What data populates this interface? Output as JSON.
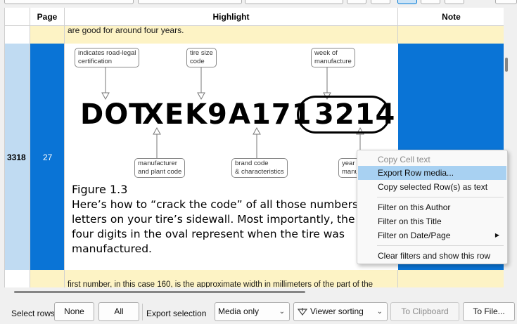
{
  "grid": {
    "columns": [
      "Page",
      "Highlight",
      "Note"
    ],
    "rows": [
      {
        "highlight": "are good for around four years."
      },
      {
        "id": "3318",
        "page": "27",
        "figure": {
          "callouts": {
            "certification": [
              "indicates road-legal",
              "certification"
            ],
            "tire_size": [
              "tire size",
              "code"
            ],
            "week": [
              "week of",
              "manufacture"
            ],
            "manufacturer": [
              "manufacturer",
              "and plant code"
            ],
            "brand": [
              "brand code",
              "& characteristics"
            ],
            "year": [
              "year o",
              "manu"
            ]
          },
          "code_parts": [
            "DOT",
            "XE",
            "K9",
            "A171",
            "3214"
          ],
          "title": "Figure 1.3",
          "caption": "Here’s how to “crack the code” of all those numbers and letters on your tire’s sidewall. Most importantly, the last four digits in the oval represent when the tire was manufactured."
        }
      },
      {
        "highlight": "first number, in this case 160, is the approximate width in millimeters of the part of the"
      }
    ]
  },
  "context_menu": {
    "items": [
      {
        "label": "Copy Cell text",
        "disabled": true
      },
      {
        "label": "Export Row media...",
        "highlighted": true
      },
      {
        "label": "Copy selected Row(s) as text"
      },
      {
        "label": "Filter on this Author"
      },
      {
        "label": "Filter on this Title"
      },
      {
        "label": "Filter on Date/Page",
        "submenu": true
      },
      {
        "label": "Clear filters and show this row"
      }
    ]
  },
  "bottom": {
    "select_rows_label": "Select rows",
    "none_label": "None",
    "all_label": "All",
    "export_selection_label": "Export selection",
    "media_select": "Media only",
    "sorting_select": "Viewer sorting",
    "clipboard_label": "To Clipboard",
    "file_label": "To File..."
  },
  "colors": {
    "selection_blue": "#0a74d6",
    "highlight_yellow": "#fdf3c5",
    "menu_highlight": "#a8d1f2"
  }
}
